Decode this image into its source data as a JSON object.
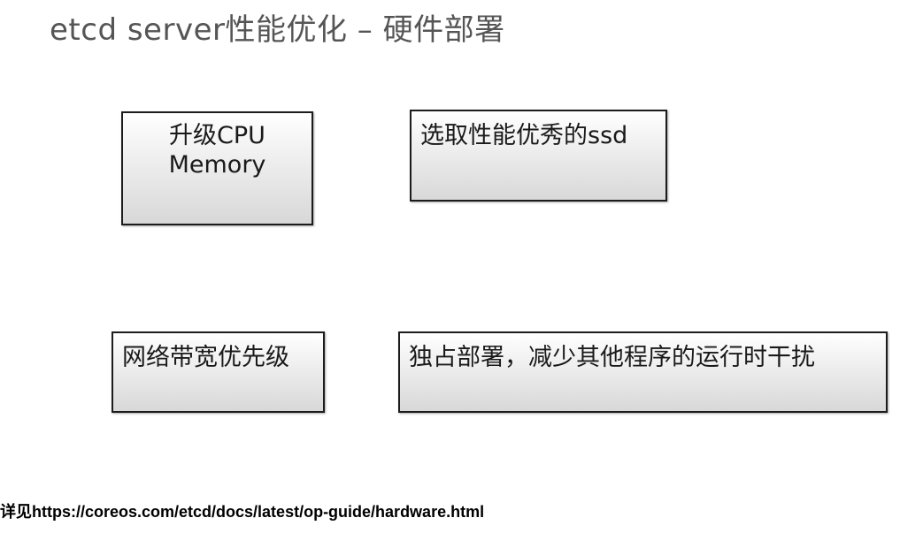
{
  "title": "etcd server性能优化 – 硬件部署",
  "boxes": {
    "cpu": {
      "line1": "升级CPU",
      "line2": "Memory"
    },
    "ssd": {
      "text": "选取性能优秀的ssd"
    },
    "network": {
      "text": "网络带宽优先级"
    },
    "dedicated": {
      "text": "独占部署，减少其他程序的运行时干扰"
    }
  },
  "footer": {
    "prefix": "详见",
    "link": "https://coreos.com/etcd/docs/latest/op-guide/hardware.html"
  }
}
